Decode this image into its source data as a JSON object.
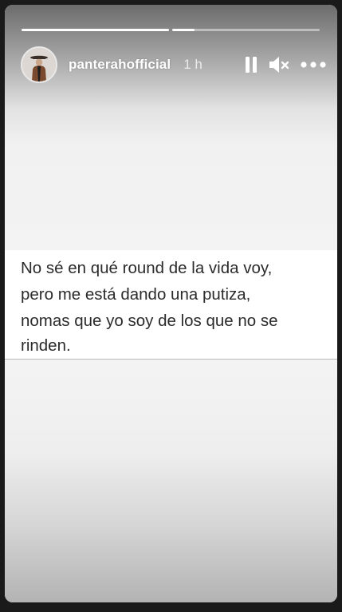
{
  "story": {
    "username": "panterahofficial",
    "time_ago": "1 h",
    "progress": [
      {
        "fraction": 1.0
      },
      {
        "fraction": 0.15
      }
    ],
    "icons": {
      "avatar": "profile-avatar",
      "pause": "pause-icon",
      "mute": "mute-icon",
      "more": "more-options-icon"
    },
    "text_lines": [
      "No sé en qué round de la vida voy,",
      "pero me está dando una putiza,",
      "nomas que yo soy de los que no se",
      "rinden."
    ]
  },
  "colors": {
    "overlay_text": "#ffffff",
    "body_text": "#2b2b2b",
    "card_bg": "#ffffff",
    "frame_bg": "#1a1a1a"
  }
}
